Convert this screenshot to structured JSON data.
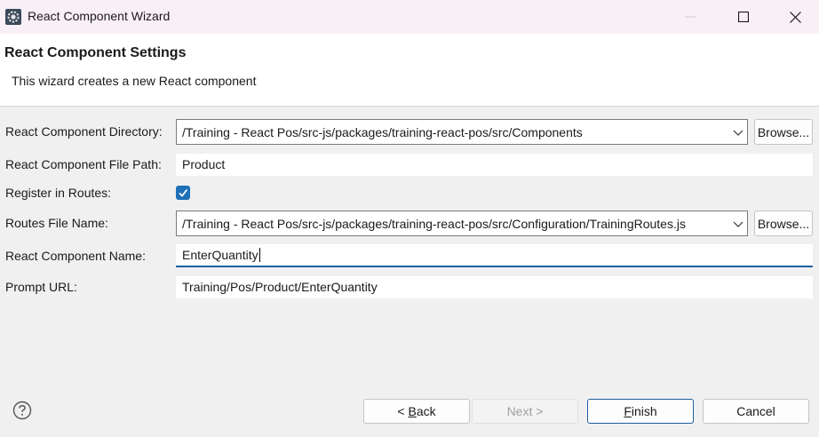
{
  "window": {
    "title": "React Component Wizard"
  },
  "header": {
    "title": "React Component Settings",
    "description": "This wizard creates a new React component"
  },
  "form": {
    "component_directory": {
      "label": "React Component Directory:",
      "value": "/Training - React Pos/src-js/packages/training-react-pos/src/Components",
      "browse_label": "Browse..."
    },
    "file_path": {
      "label": "React Component File Path:",
      "value": "Product"
    },
    "register_routes": {
      "label": "Register in Routes:",
      "checked": true
    },
    "routes_file": {
      "label": "Routes File Name:",
      "value": "/Training - React Pos/src-js/packages/training-react-pos/src/Configuration/TrainingRoutes.js",
      "browse_label": "Browse..."
    },
    "component_name": {
      "label": "React Component Name:",
      "value": "EnterQuantity"
    },
    "prompt_url": {
      "label": "Prompt URL:",
      "value": "Training/Pos/Product/EnterQuantity"
    }
  },
  "buttons": {
    "back_mnemonic": "B",
    "back_rest": "ack",
    "back_prefix": "< ",
    "next_label": "Next >",
    "finish_mnemonic": "F",
    "finish_rest": "inish",
    "cancel_label": "Cancel"
  },
  "icons": {
    "app": "eclipse-gear-icon",
    "help": "help-icon"
  },
  "colors": {
    "accent": "#1d6fb8",
    "focus_underline": "#1a5f9e"
  }
}
